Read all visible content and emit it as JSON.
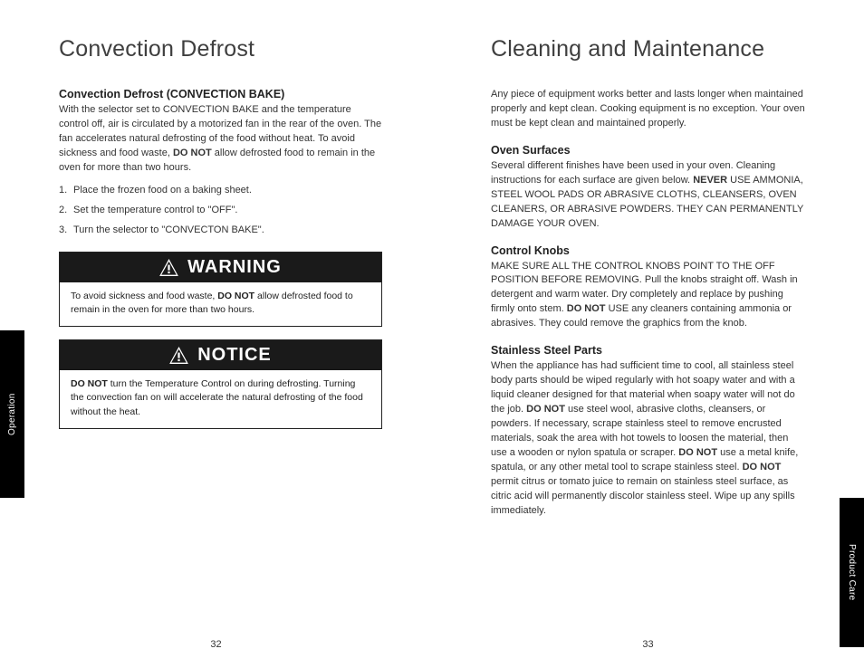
{
  "left": {
    "title": "Convection Defrost",
    "section_heading": "Convection Defrost (CONVECTION BAKE)",
    "intro_a": "With the selector set to CONVECTION BAKE and the temperature control off, air is circulated by a motorized fan in the rear of the oven. The fan accelerates natural defrosting of the food without heat. To avoid sickness and food waste, ",
    "intro_bold": "DO NOT",
    "intro_b": " allow defrosted food to remain in the oven for more than two hours.",
    "step1_num": "1.",
    "step1": "Place the frozen food on a baking sheet.",
    "step2_num": "2.",
    "step2": "Set the temperature control to \"OFF\".",
    "step3_num": "3.",
    "step3": "Turn the selector to \"CONVECTON BAKE\".",
    "warning_label": "WARNING",
    "warning_a": "To avoid sickness and food waste, ",
    "warning_bold": "DO NOT",
    "warning_b": " allow defrosted food to remain in the oven for more than two hours.",
    "notice_label": "NOTICE",
    "notice_bold": "DO NOT",
    "notice_a": " turn the Temperature Control on during defrosting. Turning the convection fan on will accelerate the natural defrosting of the food without the heat.",
    "page_num": "32",
    "tab": "Operation"
  },
  "right": {
    "title": "Cleaning and Maintenance",
    "intro": "Any piece of equipment works better and lasts longer when maintained properly and kept clean. Cooking equipment is no exception. Your oven must be kept clean and maintained properly.",
    "h_surfaces": "Oven Surfaces",
    "surfaces_a": "Several different finishes have been used in your oven. Cleaning instructions for each surface are given below. ",
    "surfaces_bold": "NEVER",
    "surfaces_b": " USE AMMONIA, STEEL WOOL PADS OR ABRASIVE CLOTHS, CLEANSERS, OVEN CLEANERS, OR ABRASIVE POWDERS. THEY CAN PERMANENTLY DAMAGE YOUR OVEN.",
    "h_knobs": "Control Knobs",
    "knobs_a": "MAKE SURE ALL THE CONTROL KNOBS POINT TO THE OFF POSITION BEFORE REMOVING. Pull the knobs straight off. Wash in detergent and warm water. Dry completely and replace by pushing firmly onto stem. ",
    "knobs_bold": "DO NOT",
    "knobs_b": " USE any cleaners containing ammonia or abrasives. They could remove the graphics from the knob.",
    "h_ss": "Stainless Steel Parts",
    "ss_a": "When the appliance has had sufficient time to cool, all stainless steel body parts should be wiped regularly with hot soapy water and with a liquid cleaner designed for that material when soapy water will not do the job. ",
    "ss_bold1": "DO NOT",
    "ss_b": " use steel wool, abrasive cloths, cleansers, or powders. If necessary, scrape stainless steel to remove encrusted materials, soak the area with hot towels to loosen the material, then use a wooden or nylon spatula or scraper. ",
    "ss_bold2": "DO NOT",
    "ss_c": " use a metal knife, spatula, or any other metal tool to scrape stainless steel. ",
    "ss_bold3": "DO NOT",
    "ss_d": " permit citrus or tomato juice to remain on stainless steel surface, as citric acid will permanently discolor stainless steel. Wipe up any spills immediately.",
    "page_num": "33",
    "tab": "Product Care"
  }
}
